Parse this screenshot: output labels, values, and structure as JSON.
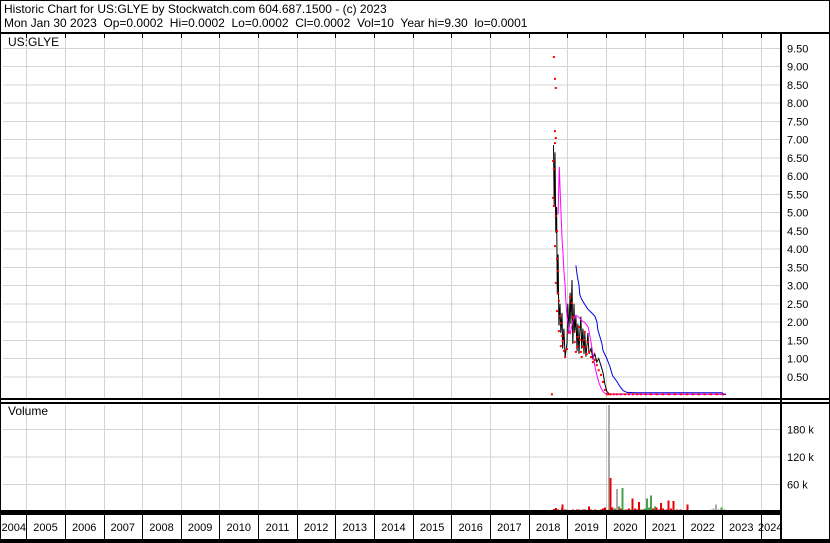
{
  "window": {
    "title_line1": "Historic Chart for US:GLYE by Stockwatch.com 604.687.1500 - (c) 2023",
    "title_line2": "Mon Jan 30 2023  Op=0.0002  Hi=0.0002  Lo=0.0002  Cl=0.0002  Vol=10  Year hi=9.30  lo=0.0001"
  },
  "price_panel": {
    "symbol_label": "US:GLYE"
  },
  "volume_panel": {
    "label": "Volume"
  },
  "colors": {
    "grid": "#d4d4d4",
    "price_line": "#000000",
    "ma_fast": "#ff00ff",
    "ma_slow": "#0000dd",
    "trade_dot": "#ff0000",
    "vol_red": "#e80000",
    "vol_green": "#4aa04a",
    "vol_gray": "#aaaaaa"
  },
  "chart_data": {
    "type": "line",
    "title": "US:GLYE",
    "x_range": [
      2004.4,
      2024.5
    ],
    "price_range": [
      0,
      9.9
    ],
    "grid": true,
    "year_ticks": [
      [
        "2004",
        2004.68
      ],
      [
        "2005",
        2005.5
      ],
      [
        "2006",
        2006.5
      ],
      [
        "2007",
        2007.5
      ],
      [
        "2008",
        2008.5
      ],
      [
        "2009",
        2009.5
      ],
      [
        "2010",
        2010.5
      ],
      [
        "2011",
        2011.5
      ],
      [
        "2012",
        2012.5
      ],
      [
        "2013",
        2013.5
      ],
      [
        "2014",
        2014.5
      ],
      [
        "2015",
        2015.5
      ],
      [
        "2016",
        2016.5
      ],
      [
        "2017",
        2017.5
      ],
      [
        "2018",
        2018.5
      ],
      [
        "2019",
        2019.5
      ],
      [
        "2020",
        2020.5
      ],
      [
        "2021",
        2021.5
      ],
      [
        "2022",
        2022.5
      ],
      [
        "2023",
        2023.5
      ],
      [
        "2024",
        2024.25
      ]
    ],
    "price_ticks": [
      [
        "9.50",
        9.5
      ],
      [
        "9.00",
        9.0
      ],
      [
        "8.50",
        8.5
      ],
      [
        "8.00",
        8.0
      ],
      [
        "7.50",
        7.5
      ],
      [
        "7.00",
        7.0
      ],
      [
        "6.50",
        6.5
      ],
      [
        "6.00",
        6.0
      ],
      [
        "5.50",
        5.5
      ],
      [
        "5.00",
        5.0
      ],
      [
        "4.50",
        4.5
      ],
      [
        "4.00",
        4.0
      ],
      [
        "3.50",
        3.5
      ],
      [
        "3.00",
        3.0
      ],
      [
        "2.50",
        2.5
      ],
      [
        "2.00",
        2.0
      ],
      [
        "1.50",
        1.5
      ],
      [
        "1.00",
        1.0
      ],
      [
        "0.50",
        0.5
      ]
    ],
    "volume_ticks": [
      [
        "180 k",
        180000
      ],
      [
        "120 k",
        120000
      ],
      [
        "60 k",
        60000
      ]
    ],
    "series": [
      {
        "name": "price",
        "color_key": "price_line",
        "points": [
          [
            2018.64,
            6.85
          ],
          [
            2018.66,
            5.15
          ],
          [
            2018.68,
            6.65
          ],
          [
            2018.7,
            4.45
          ],
          [
            2018.72,
            5.15
          ],
          [
            2018.74,
            2.75
          ],
          [
            2018.76,
            3.85
          ],
          [
            2018.78,
            1.9
          ],
          [
            2018.81,
            2.5
          ],
          [
            2018.83,
            1.7
          ],
          [
            2018.86,
            2.25
          ],
          [
            2018.88,
            1.27
          ],
          [
            2018.91,
            1.82
          ],
          [
            2018.94,
            1.05
          ],
          [
            2018.99,
            1.4
          ],
          [
            2019.01,
            2.5
          ],
          [
            2019.04,
            1.7
          ],
          [
            2019.07,
            2.8
          ],
          [
            2019.09,
            1.95
          ],
          [
            2019.12,
            3.15
          ],
          [
            2019.14,
            1.4
          ],
          [
            2019.17,
            2.5
          ],
          [
            2019.19,
            1.7
          ],
          [
            2019.22,
            2.15
          ],
          [
            2019.25,
            1.2
          ],
          [
            2019.27,
            1.95
          ],
          [
            2019.3,
            1.13
          ],
          [
            2019.32,
            1.7
          ],
          [
            2019.35,
            2.15
          ],
          [
            2019.37,
            1.27
          ],
          [
            2019.4,
            1.82
          ],
          [
            2019.43,
            1.13
          ],
          [
            2019.45,
            1.7
          ],
          [
            2019.48,
            1.05
          ],
          [
            2019.51,
            1.4
          ],
          [
            2019.53,
            1.7
          ],
          [
            2019.56,
            1.13
          ],
          [
            2019.61,
            1.27
          ],
          [
            2019.66,
            1.0
          ],
          [
            2019.71,
            1.13
          ],
          [
            2019.76,
            0.9
          ],
          [
            2019.81,
            1.0
          ],
          [
            2019.87,
            0.8
          ],
          [
            2019.92,
            0.62
          ],
          [
            2019.97,
            0.3
          ],
          [
            2020.02,
            0.1
          ],
          [
            2020.08,
            0.03
          ],
          [
            2020.3,
            0.02
          ],
          [
            2020.6,
            0.03
          ],
          [
            2021.0,
            0.02
          ],
          [
            2021.5,
            0.02
          ],
          [
            2022.0,
            0.02
          ],
          [
            2022.5,
            0.02
          ],
          [
            2023.1,
            0.02
          ]
        ]
      },
      {
        "name": "ma-fast",
        "color_key": "ma_fast",
        "points": [
          [
            2018.76,
            4.95
          ],
          [
            2018.79,
            6.25
          ],
          [
            2018.81,
            5.7
          ],
          [
            2018.84,
            4.85
          ],
          [
            2018.86,
            4.3
          ],
          [
            2018.89,
            3.85
          ],
          [
            2018.91,
            3.4
          ],
          [
            2018.94,
            3.0
          ],
          [
            2018.96,
            2.6
          ],
          [
            2018.99,
            2.15
          ],
          [
            2019.04,
            1.82
          ],
          [
            2019.07,
            1.66
          ],
          [
            2019.09,
            1.77
          ],
          [
            2019.12,
            1.91
          ],
          [
            2019.14,
            2.02
          ],
          [
            2019.17,
            2.13
          ],
          [
            2019.22,
            2.18
          ],
          [
            2019.27,
            2.15
          ],
          [
            2019.32,
            2.1
          ],
          [
            2019.37,
            2.04
          ],
          [
            2019.43,
            2.0
          ],
          [
            2019.48,
            1.95
          ],
          [
            2019.53,
            1.88
          ],
          [
            2019.56,
            1.75
          ],
          [
            2019.61,
            1.45
          ],
          [
            2019.66,
            1.13
          ],
          [
            2019.71,
            0.8
          ],
          [
            2019.76,
            0.55
          ],
          [
            2019.81,
            0.36
          ],
          [
            2019.87,
            0.19
          ],
          [
            2019.92,
            0.1
          ],
          [
            2019.97,
            0.05
          ],
          [
            2020.05,
            0.03
          ],
          [
            2020.3,
            0.02
          ],
          [
            2021.0,
            0.02
          ],
          [
            2022.0,
            0.02
          ],
          [
            2023.1,
            0.02
          ]
        ]
      },
      {
        "name": "ma-slow",
        "color_key": "ma_slow",
        "points": [
          [
            2019.22,
            3.55
          ],
          [
            2019.25,
            3.3
          ],
          [
            2019.3,
            3.0
          ],
          [
            2019.32,
            2.75
          ],
          [
            2019.37,
            2.62
          ],
          [
            2019.45,
            2.48
          ],
          [
            2019.53,
            2.35
          ],
          [
            2019.63,
            2.25
          ],
          [
            2019.71,
            2.16
          ],
          [
            2019.76,
            2.02
          ],
          [
            2019.79,
            1.78
          ],
          [
            2019.84,
            1.6
          ],
          [
            2019.89,
            1.42
          ],
          [
            2019.92,
            1.22
          ],
          [
            2020.02,
            1.0
          ],
          [
            2020.1,
            0.78
          ],
          [
            2020.17,
            0.53
          ],
          [
            2020.28,
            0.37
          ],
          [
            2020.36,
            0.23
          ],
          [
            2020.44,
            0.12
          ],
          [
            2020.54,
            0.07
          ],
          [
            2020.8,
            0.06
          ],
          [
            2021.2,
            0.06
          ],
          [
            2021.8,
            0.06
          ],
          [
            2022.4,
            0.06
          ],
          [
            2023.0,
            0.06
          ],
          [
            2023.05,
            0.02
          ],
          [
            2023.1,
            0.02
          ]
        ]
      }
    ],
    "dots": {
      "name": "trades",
      "color_key": "trade_dot",
      "points": [
        [
          2018.6,
          0.02
        ],
        [
          2018.65,
          9.26
        ],
        [
          2018.68,
          8.66
        ],
        [
          2018.7,
          8.41
        ],
        [
          2018.68,
          7.23
        ],
        [
          2018.7,
          7.04
        ],
        [
          2018.68,
          6.9
        ],
        [
          2018.63,
          6.41
        ],
        [
          2018.65,
          6.19
        ],
        [
          2018.63,
          5.4
        ],
        [
          2018.65,
          5.18
        ],
        [
          2018.7,
          4.9
        ],
        [
          2018.73,
          4.49
        ],
        [
          2018.68,
          4.08
        ],
        [
          2018.73,
          3.73
        ],
        [
          2018.76,
          3.4
        ],
        [
          2018.7,
          3.07
        ],
        [
          2018.76,
          2.79
        ],
        [
          2018.78,
          2.58
        ],
        [
          2018.73,
          2.3
        ],
        [
          2018.81,
          2.16
        ],
        [
          2018.83,
          1.97
        ],
        [
          2018.78,
          1.75
        ],
        [
          2018.86,
          1.62
        ],
        [
          2018.88,
          1.48
        ],
        [
          2018.83,
          1.34
        ],
        [
          2018.91,
          1.21
        ],
        [
          2018.94,
          1.04
        ],
        [
          2018.99,
          1.26
        ],
        [
          2019.01,
          1.7
        ],
        [
          2019.07,
          2.68
        ],
        [
          2019.12,
          2.52
        ],
        [
          2019.14,
          2.14
        ],
        [
          2019.17,
          1.73
        ],
        [
          2019.19,
          1.45
        ],
        [
          2019.22,
          1.18
        ],
        [
          2019.25,
          1.32
        ],
        [
          2019.27,
          1.59
        ],
        [
          2019.3,
          1.86
        ],
        [
          2019.32,
          1.51
        ],
        [
          2019.35,
          1.18
        ],
        [
          2019.37,
          1.04
        ],
        [
          2019.4,
          1.32
        ],
        [
          2019.43,
          1.51
        ],
        [
          2019.45,
          1.73
        ],
        [
          2019.48,
          1.32
        ],
        [
          2019.5,
          1.12
        ],
        [
          2019.53,
          1.45
        ],
        [
          2019.56,
          1.18
        ],
        [
          2019.61,
          1.04
        ],
        [
          2019.66,
          0.9
        ],
        [
          2019.71,
          0.96
        ],
        [
          2019.76,
          0.82
        ],
        [
          2019.81,
          0.68
        ],
        [
          2019.87,
          0.55
        ],
        [
          2019.92,
          0.36
        ],
        [
          2019.97,
          0.14
        ],
        [
          2020.02,
          0.02
        ],
        [
          2020.07,
          0.02
        ],
        [
          2020.12,
          0.02
        ],
        [
          2020.2,
          0.02
        ],
        [
          2020.28,
          0.02
        ],
        [
          2020.38,
          0.02
        ],
        [
          2020.49,
          0.02
        ],
        [
          2020.59,
          0.02
        ],
        [
          2020.69,
          0.02
        ],
        [
          2020.8,
          0.02
        ],
        [
          2020.9,
          0.02
        ],
        [
          2021.03,
          0.02
        ],
        [
          2021.16,
          0.02
        ],
        [
          2021.31,
          0.02
        ],
        [
          2021.47,
          0.02
        ],
        [
          2021.62,
          0.02
        ],
        [
          2021.78,
          0.02
        ],
        [
          2021.93,
          0.02
        ],
        [
          2022.09,
          0.02
        ],
        [
          2022.24,
          0.02
        ],
        [
          2022.4,
          0.02
        ],
        [
          2022.55,
          0.02
        ],
        [
          2022.71,
          0.02
        ],
        [
          2022.86,
          0.02
        ],
        [
          2023.02,
          0.02
        ]
      ]
    },
    "volume_bars": [
      [
        2018.47,
        3000,
        "g"
      ],
      [
        2018.52,
        2500,
        "r"
      ],
      [
        2018.6,
        4500,
        "g"
      ],
      [
        2018.65,
        6500,
        "r"
      ],
      [
        2018.7,
        9000,
        "r"
      ],
      [
        2018.76,
        5000,
        "r"
      ],
      [
        2018.81,
        4000,
        "r"
      ],
      [
        2018.86,
        8000,
        "r"
      ],
      [
        2018.88,
        16000,
        "r"
      ],
      [
        2018.94,
        6000,
        "r"
      ],
      [
        2018.99,
        5000,
        "y"
      ],
      [
        2019.04,
        4000,
        "r"
      ],
      [
        2019.09,
        3500,
        "r"
      ],
      [
        2019.14,
        5000,
        "r"
      ],
      [
        2019.19,
        4000,
        "y"
      ],
      [
        2019.25,
        6000,
        "r"
      ],
      [
        2019.3,
        5000,
        "r"
      ],
      [
        2019.35,
        4000,
        "r"
      ],
      [
        2019.4,
        6500,
        "y"
      ],
      [
        2019.45,
        5000,
        "r"
      ],
      [
        2019.5,
        4000,
        "r"
      ],
      [
        2019.56,
        12000,
        "r"
      ],
      [
        2019.61,
        6000,
        "r"
      ],
      [
        2019.66,
        4000,
        "r"
      ],
      [
        2019.71,
        5000,
        "r"
      ],
      [
        2019.76,
        3500,
        "r"
      ],
      [
        2019.81,
        4500,
        "r"
      ],
      [
        2019.87,
        6000,
        "r"
      ],
      [
        2019.92,
        8000,
        "r"
      ],
      [
        2019.97,
        10000,
        "r"
      ],
      [
        2020.02,
        4500,
        "r"
      ],
      [
        2020.07,
        1000000,
        "y"
      ],
      [
        2020.12,
        74000,
        "r"
      ],
      [
        2020.17,
        10000,
        "r"
      ],
      [
        2020.23,
        8000,
        "g"
      ],
      [
        2020.28,
        50000,
        "y"
      ],
      [
        2020.33,
        12000,
        "g"
      ],
      [
        2020.38,
        8000,
        "r"
      ],
      [
        2020.43,
        52000,
        "g"
      ],
      [
        2020.49,
        6000,
        "g"
      ],
      [
        2020.54,
        5000,
        "r"
      ],
      [
        2020.59,
        8000,
        "r"
      ],
      [
        2020.64,
        6000,
        "g"
      ],
      [
        2020.69,
        30000,
        "r"
      ],
      [
        2020.75,
        8000,
        "r"
      ],
      [
        2020.8,
        5000,
        "r"
      ],
      [
        2020.85,
        22000,
        "r"
      ],
      [
        2020.9,
        6000,
        "g"
      ],
      [
        2020.95,
        5000,
        "r"
      ],
      [
        2021.01,
        8000,
        "g"
      ],
      [
        2021.06,
        30000,
        "g"
      ],
      [
        2021.11,
        10000,
        "g"
      ],
      [
        2021.16,
        36000,
        "g"
      ],
      [
        2021.21,
        8000,
        "r"
      ],
      [
        2021.26,
        12000,
        "g"
      ],
      [
        2021.31,
        10000,
        "r"
      ],
      [
        2021.37,
        6000,
        "r"
      ],
      [
        2021.42,
        20000,
        "r"
      ],
      [
        2021.47,
        8000,
        "r"
      ],
      [
        2021.52,
        6000,
        "y"
      ],
      [
        2021.57,
        5000,
        "r"
      ],
      [
        2021.62,
        25000,
        "r"
      ],
      [
        2021.68,
        8000,
        "r"
      ],
      [
        2021.75,
        24000,
        "r"
      ],
      [
        2021.83,
        6000,
        "r"
      ],
      [
        2021.93,
        5000,
        "r"
      ],
      [
        2022.04,
        4000,
        "r"
      ],
      [
        2022.11,
        16000,
        "r"
      ],
      [
        2022.19,
        4000,
        "y"
      ],
      [
        2022.29,
        3000,
        "g"
      ],
      [
        2022.4,
        4000,
        "y"
      ],
      [
        2022.5,
        3000,
        "g"
      ],
      [
        2022.6,
        4000,
        "r"
      ],
      [
        2022.71,
        5000,
        "y"
      ],
      [
        2022.78,
        8000,
        "y"
      ],
      [
        2022.84,
        16000,
        "y"
      ],
      [
        2022.91,
        6000,
        "g"
      ],
      [
        2022.99,
        10000,
        "g"
      ],
      [
        2023.07,
        5000,
        "g"
      ]
    ]
  }
}
